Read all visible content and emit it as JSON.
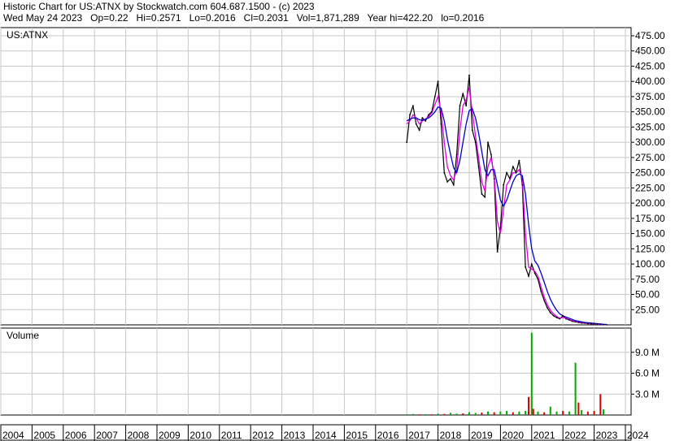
{
  "header": {
    "line1": "Historic Chart for US:ATNX by Stockwatch.com 604.687.1500 - (c) 2023",
    "line2": "Wed May 24 2023   Op=0.22   Hi=0.2571   Lo=0.2016   Cl=0.2031   Vol=1,871,289   Year hi=422.20   lo=0.2016"
  },
  "colors": {
    "price": "#000000",
    "ma_short": "#e000e0",
    "ma_long": "#0000cc",
    "vol_up": "#00aa00",
    "vol_down": "#dd0000",
    "grid": "#c8c8c8"
  },
  "chart_data": [
    {
      "type": "line",
      "title": "US:ATNX",
      "ylim": [
        0,
        475
      ],
      "y_ticks": [
        "25.00",
        "50.00",
        "75.00",
        "100.00",
        "125.00",
        "150.00",
        "175.00",
        "200.00",
        "225.00",
        "250.00",
        "275.00",
        "300.00",
        "325.00",
        "350.00",
        "375.00",
        "400.00",
        "425.00",
        "450.00",
        "475.00"
      ],
      "x": [
        2017.0,
        2017.1,
        2017.2,
        2017.3,
        2017.4,
        2017.5,
        2017.6,
        2017.7,
        2017.8,
        2017.9,
        2018.0,
        2018.1,
        2018.2,
        2018.3,
        2018.4,
        2018.5,
        2018.6,
        2018.7,
        2018.8,
        2018.9,
        2019.0,
        2019.1,
        2019.2,
        2019.3,
        2019.4,
        2019.5,
        2019.6,
        2019.7,
        2019.8,
        2019.9,
        2020.0,
        2020.1,
        2020.2,
        2020.3,
        2020.4,
        2020.5,
        2020.6,
        2020.7,
        2020.8,
        2020.9,
        2021.0,
        2021.1,
        2021.2,
        2021.3,
        2021.4,
        2021.5,
        2021.6,
        2021.7,
        2021.8,
        2021.9,
        2022.0,
        2022.1,
        2022.2,
        2022.3,
        2022.4,
        2022.5,
        2022.6,
        2022.7,
        2022.8,
        2022.9,
        2023.0,
        2023.1,
        2023.2,
        2023.3,
        2023.4
      ],
      "series": [
        {
          "values": [
            300,
            345,
            360,
            330,
            320,
            340,
            335,
            345,
            350,
            375,
            400,
            330,
            250,
            235,
            240,
            230,
            280,
            360,
            380,
            360,
            410,
            320,
            300,
            260,
            215,
            210,
            300,
            280,
            240,
            120,
            160,
            230,
            250,
            240,
            260,
            250,
            270,
            230,
            95,
            80,
            100,
            85,
            75,
            55,
            40,
            28,
            20,
            15,
            12,
            10,
            15,
            10,
            8,
            6,
            5,
            4,
            3,
            3,
            2,
            2,
            1.5,
            1,
            0.6,
            0.3,
            0.2
          ]
        },
        {
          "values": [
            330,
            335,
            345,
            340,
            330,
            335,
            338,
            342,
            348,
            362,
            375,
            350,
            300,
            260,
            245,
            238,
            255,
            320,
            360,
            370,
            390,
            350,
            310,
            275,
            235,
            220,
            260,
            275,
            245,
            170,
            150,
            190,
            230,
            238,
            250,
            250,
            255,
            240,
            150,
            95,
            92,
            88,
            80,
            62,
            46,
            33,
            24,
            18,
            14,
            11,
            12,
            11,
            9,
            7,
            5.5,
            4.5,
            3.5,
            3,
            2.4,
            2,
            1.6,
            1.1,
            0.7,
            0.4,
            0.3
          ]
        },
        {
          "values": [
            335,
            338,
            340,
            340,
            337,
            336,
            338,
            340,
            344,
            350,
            358,
            356,
            335,
            305,
            280,
            258,
            250,
            270,
            300,
            330,
            352,
            355,
            340,
            315,
            285,
            255,
            245,
            255,
            255,
            230,
            205,
            195,
            205,
            220,
            235,
            245,
            248,
            245,
            215,
            165,
            125,
            105,
            98,
            85,
            70,
            55,
            42,
            32,
            24,
            18,
            15,
            13,
            11,
            9,
            7,
            6,
            5,
            4,
            3.5,
            3,
            2.5,
            2,
            1.5,
            1,
            0.7
          ]
        }
      ]
    },
    {
      "type": "bar",
      "title": "Volume",
      "ylim": [
        0,
        12
      ],
      "y_ticks": [
        "3.0 M",
        "6.0 M",
        "9.0 M"
      ],
      "x": [
        2017.0,
        2017.2,
        2017.4,
        2017.6,
        2017.8,
        2018.0,
        2018.2,
        2018.4,
        2018.6,
        2018.8,
        2019.0,
        2019.2,
        2019.4,
        2019.6,
        2019.8,
        2020.0,
        2020.2,
        2020.4,
        2020.6,
        2020.8,
        2020.9,
        2021.0,
        2021.05,
        2021.2,
        2021.4,
        2021.6,
        2021.8,
        2022.0,
        2022.2,
        2022.4,
        2022.5,
        2022.6,
        2022.8,
        2023.0,
        2023.2,
        2023.3
      ],
      "values": [
        0.1,
        0.15,
        0.1,
        0.12,
        0.1,
        0.2,
        0.15,
        0.3,
        0.2,
        0.25,
        0.4,
        0.3,
        0.35,
        0.5,
        0.4,
        0.5,
        0.6,
        0.4,
        0.5,
        0.6,
        2.6,
        11.8,
        0.9,
        0.5,
        0.4,
        1.2,
        0.5,
        0.6,
        0.5,
        7.5,
        1.8,
        0.7,
        0.5,
        0.6,
        3.0,
        0.8
      ],
      "up": [
        1,
        1,
        0,
        1,
        0,
        1,
        0,
        1,
        1,
        0,
        1,
        1,
        0,
        1,
        0,
        1,
        1,
        0,
        1,
        1,
        0,
        1,
        0,
        1,
        0,
        1,
        1,
        0,
        1,
        1,
        0,
        1,
        0,
        0,
        0,
        1
      ]
    }
  ],
  "x_axis": {
    "labels": [
      "2004",
      "2005",
      "2006",
      "2007",
      "2008",
      "2009",
      "2010",
      "2011",
      "2012",
      "2013",
      "2014",
      "2015",
      "2016",
      "2017",
      "2018",
      "2019",
      "2020",
      "2021",
      "2022",
      "2023",
      "2024"
    ]
  }
}
